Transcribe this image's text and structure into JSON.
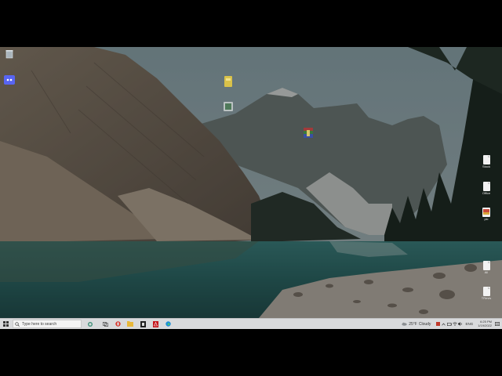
{
  "desktop": {
    "left_icons": [
      {
        "name": "recycle-bin-icon",
        "label": ""
      },
      {
        "name": "discord-icon",
        "label": ""
      }
    ],
    "middle_icons": [
      {
        "name": "folder-icon",
        "label": ""
      },
      {
        "name": "recorder-app-icon",
        "label": ""
      },
      {
        "name": "winrar-icon",
        "label": ""
      }
    ],
    "right_icons": [
      {
        "name": "document-icon",
        "label": "Stock"
      },
      {
        "name": "document-icon",
        "label": "Office"
      },
      {
        "name": "image-file-icon",
        "label": "pic"
      },
      {
        "name": "document-icon",
        "label": "All"
      },
      {
        "name": "document-icon",
        "label": "TRevis"
      }
    ]
  },
  "taskbar": {
    "search_placeholder": "Type here to search",
    "pinned_apps": [
      "task-view-icon",
      "opera-icon",
      "file-explorer-icon",
      "epic-games-icon",
      "adobe-reader-icon",
      "edge-icon"
    ],
    "weather": {
      "temp": "25°F",
      "condition": "Cloudy"
    },
    "language": "ENG",
    "time": "6:25 PM",
    "date": "1/19/2022",
    "colors": {
      "taskbar_bg": "#d9dadc",
      "accent": "#2b79d8"
    }
  }
}
